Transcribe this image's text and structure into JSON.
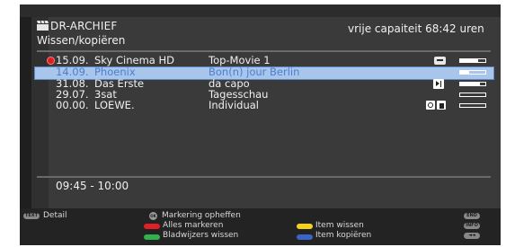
{
  "header": {
    "title": "DR-ARCHIEF",
    "subtitle": "Wissen/kopiëren",
    "capacity": "vrije capaiteit 68:42 uren",
    "icon": "clapperboard-icon"
  },
  "recordings": [
    {
      "date": "15.09.",
      "channel": "Sky Cinema HD",
      "title": "Top-Movie 1",
      "icons": [
        "recording-dot-icon",
        "text-badge-icon"
      ],
      "progress": 0.72,
      "selected": false
    },
    {
      "date": "14.09.",
      "channel": "Phoenix",
      "title": "Bon(n) jour Berlin",
      "icons": [],
      "progress": 0.35,
      "selected": true
    },
    {
      "date": "31.08.",
      "channel": "Das Erste",
      "title": "da capo",
      "icons": [
        "skip-icon"
      ],
      "progress": 0.8,
      "selected": false
    },
    {
      "date": "29.07.",
      "channel": "3sat",
      "title": "Tagesschau",
      "icons": [],
      "progress": 0.0,
      "selected": false
    },
    {
      "date": "00.00.",
      "channel": "LOEWE.",
      "title": "Individual",
      "icons": [
        "camera-icon",
        "folder-icon"
      ],
      "progress": 0.0,
      "selected": false
    }
  ],
  "time_range": "09:45 - 10:00",
  "footer": {
    "text_key": "TEXT",
    "detail": "Detail",
    "ok_key": "OK",
    "unmark": "Markering opheffen",
    "mark_all": "Alles markeren",
    "delete_bookmarks": "Bladwijzers wissen",
    "delete_item": "Item wissen",
    "copy_item": "Item kopiëren",
    "end_key": "END",
    "info_key": "INFO",
    "back_key": "◄◄"
  },
  "colors": {
    "red": "#e01f26",
    "green": "#2fb34a",
    "yellow": "#f2d21b",
    "blue": "#3b64c8",
    "selection": "#a8c5ec"
  }
}
